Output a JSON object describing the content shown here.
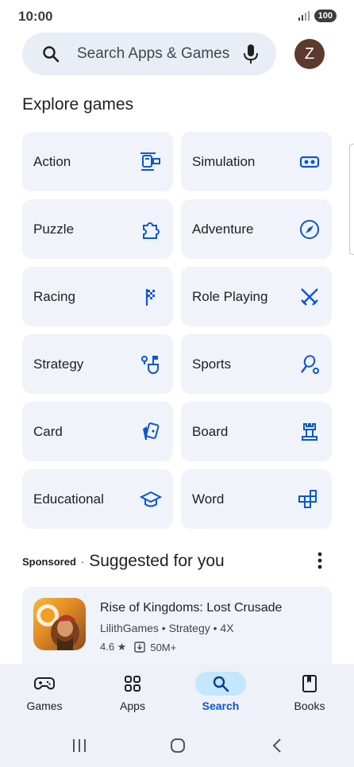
{
  "status": {
    "time": "10:00",
    "battery": "100"
  },
  "search": {
    "placeholder": "Search Apps & Games",
    "avatar_letter": "Z"
  },
  "explore": {
    "title": "Explore games",
    "categories": [
      {
        "label": "Action",
        "icon": "helicopter-icon"
      },
      {
        "label": "Simulation",
        "icon": "vr-headset-icon"
      },
      {
        "label": "Puzzle",
        "icon": "puzzle-piece-icon"
      },
      {
        "label": "Adventure",
        "icon": "compass-icon"
      },
      {
        "label": "Racing",
        "icon": "checkered-flag-icon"
      },
      {
        "label": "Role Playing",
        "icon": "crossed-swords-icon"
      },
      {
        "label": "Strategy",
        "icon": "strategy-flag-icon"
      },
      {
        "label": "Sports",
        "icon": "racket-icon"
      },
      {
        "label": "Card",
        "icon": "cards-icon"
      },
      {
        "label": "Board",
        "icon": "chess-rook-icon"
      },
      {
        "label": "Educational",
        "icon": "graduation-cap-icon"
      },
      {
        "label": "Word",
        "icon": "word-tiles-icon"
      }
    ]
  },
  "suggested": {
    "sponsored_label": "Sponsored",
    "separator": "·",
    "title": "Suggested for you",
    "app": {
      "name": "Rise of Kingdoms: Lost Crusade",
      "meta": "LilithGames • Strategy • 4X",
      "rating": "4.6 ★",
      "downloads": "50M+"
    }
  },
  "bottom_nav": [
    {
      "label": "Games",
      "icon": "gamepad-icon",
      "active": false
    },
    {
      "label": "Apps",
      "icon": "apps-grid-icon",
      "active": false
    },
    {
      "label": "Search",
      "icon": "search-icon",
      "active": true
    },
    {
      "label": "Books",
      "icon": "book-icon",
      "active": false
    }
  ],
  "colors": {
    "accent": "#0b57d0",
    "tile_bg": "#f0f3f9",
    "search_bg": "#e9eef6",
    "nav_active_bg": "#c2e7ff"
  }
}
